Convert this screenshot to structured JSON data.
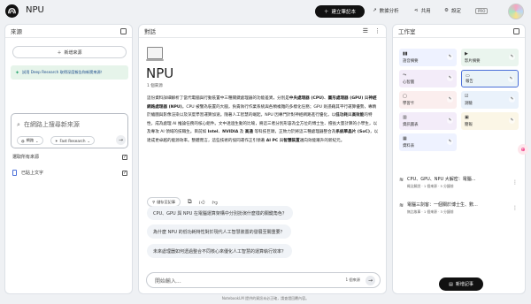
{
  "header": {
    "title": "NPU",
    "create_label": "建立筆記本",
    "analytics_label": "數據分析",
    "share_label": "共用",
    "settings_label": "設定",
    "plan_badge": "PRO"
  },
  "sources": {
    "title": "來源",
    "add_label": "新增來源",
    "promo": "試用 Deep Research 取得深度報告和新獎來源！",
    "search_placeholder": "在網路上搜尋新來源",
    "web_chip": "網路",
    "research_chip": "Fast Research",
    "select_all": "選取所有來源",
    "items": [
      {
        "name": "已貼上文字"
      }
    ]
  },
  "chat": {
    "title": "對話",
    "notebook_title": "NPU",
    "meta": "1 個來源",
    "summary": [
      "這份資料詳細解析了當代電腦與行動裝置中三種關鍵處理器的功能差異，分別是",
      "中央處理器 (CPU)",
      "、",
      "圖形處理器 (GPU)",
      " 與",
      "神經網路處理器 (NPU)",
      "。CPU 被譬為裝置的大腦，負責執行作業系統與各類複雜的多樣化任務；GPU 則憑藉其平行運算優勢，專精於繪圖與影像渲染以及深度學習運算加速。隨著人工智慧的崛起，NPU 因專門針對神經網路進行優化，以",
      "低功耗",
      "與",
      "高效能",
      "的特性，成為處理 AI 推論任務的核心組件。文中透過生動的比喻，將這三者分別形容為全方位的博士生、擅長大量計算的小學生，以及專攻 AI 領域的技職生。目前如 ",
      "Intel",
      "、",
      "NVIDIA",
      " 及 ",
      "高通",
      " 等科技巨頭，正致力於將這三種處理器整合為",
      "系統單晶片 (SoC)",
      "，以達成更卓越的能源效率。整體而言，這些技術的協同運作正引領著 ",
      "AI PC",
      " 與",
      "智慧裝置",
      "邁向效能躍升的新紀元。"
    ],
    "save_note": "儲存至記事",
    "suggestions": [
      "CPU、GPU 與 NPU 在電腦運算架構中分別扮演什麼樣的關鍵角色？",
      "為什麼 NPU 的低功耗特性對於現代人工智慧裝置的發展至關重要？",
      "未來處理器如何透過整合不同核心來優化人工智慧的運算執行效率？"
    ],
    "input_placeholder": "開始輸入...",
    "source_count": "1 個來源"
  },
  "studio": {
    "title": "工作室",
    "tiles": [
      {
        "label": "語音摘要",
        "color": "#eef2ff",
        "icon": "audio-icon"
      },
      {
        "label": "影片摘要",
        "color": "#eaf5ee",
        "icon": "video-icon"
      },
      {
        "label": "心智圖",
        "color": "#f3ecf9",
        "icon": "mindmap-icon"
      },
      {
        "label": "報告",
        "color": "#eaf3f8",
        "icon": "report-icon"
      },
      {
        "label": "學習卡",
        "color": "#fbeeee",
        "icon": "flashcard-icon"
      },
      {
        "label": "測驗",
        "color": "#eaf2fb",
        "icon": "quiz-icon"
      },
      {
        "label": "資訊圖表",
        "color": "#f3ecf9",
        "icon": "infographic-icon"
      },
      {
        "label": "簡報",
        "color": "#fbf6e6",
        "icon": "slides-icon"
      },
      {
        "label": "資料表",
        "color": "#eef2ff",
        "icon": "table-icon"
      }
    ],
    "notes": [
      {
        "title": "CPU、GPU、NPU 大解密：電腦...",
        "sub": "概念解說 · 1 個來源 · 5 分鐘前"
      },
      {
        "title": "電腦三劍客：一個關於博士生、數...",
        "sub": "無比故事 · 1 個來源 · 3 分鐘前"
      }
    ],
    "add_note_label": "新增記事"
  },
  "footer": "NotebookLM 提供的資訊未必正確，請查證回覆內容。"
}
